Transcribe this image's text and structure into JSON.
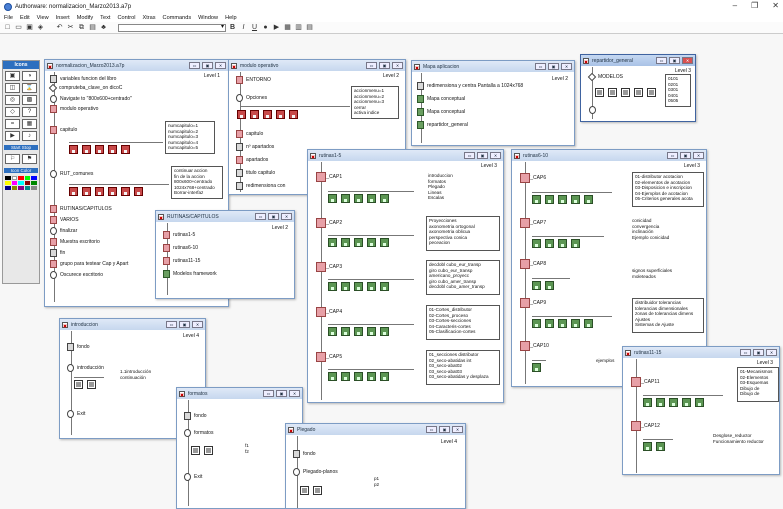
{
  "app": {
    "title": "Authorware: normalizacion_Marzo2013.a7p"
  },
  "menu": [
    "File",
    "Edit",
    "View",
    "Insert",
    "Modify",
    "Text",
    "Control",
    "Xtras",
    "Commands",
    "Window",
    "Help"
  ],
  "toolbar": {
    "bold": "B",
    "italic": "I",
    "underline": "U"
  },
  "palette": {
    "title": "Icons",
    "start_stop": "Start Stop",
    "icon_color": "Icon Color"
  },
  "win_main": {
    "title": "normalizacion_Marzo2013.a7p",
    "level": "Level 1",
    "items": [
      "variables funcion del libro",
      "compruteba_clave_on dicoC",
      "Navigate to \"800x600+centrado\"",
      "modulo operativo"
    ],
    "capitulo": "capitulo",
    "capitulo_list": [
      "numcapitulo=1",
      "numcapitulo=2",
      "numcapitulo=3",
      "numcapitulo=4",
      "numcapitulo=5"
    ],
    "rut_comunes": "RUT_comunes",
    "rut_box": [
      "continuar accion",
      "fin de la accion",
      "800x600+centrado",
      "1024x768+centrado",
      "Borrar-interfaz"
    ],
    "lower": [
      "RUTINAS/CAPITULOS",
      "VARIOS",
      "finalizar",
      "Muestra escritorio",
      "fin",
      "grupo para testear Cap y Apart",
      "Oscurece escritorio"
    ]
  },
  "win_modulo": {
    "title": "modulo operativo",
    "level": "Level 2",
    "entorno": "ENTORNO",
    "opciones": "Opciones",
    "acciones": [
      "accionmenu=1",
      "accionmenu=2",
      "accionmenu=3",
      "cerrar",
      "activa indice"
    ],
    "items": [
      "capitulo",
      "nº apartados",
      "apartados",
      "titulo capitulo",
      "redimensiona con"
    ]
  },
  "win_mapa": {
    "title": "Mapa aplicacion",
    "level": "Level 2",
    "items": [
      "redimensiona y centra Pantalla a 1024x768",
      "Mapa conceptual",
      "Mapa conceptual",
      "repartidor_general"
    ]
  },
  "win_repartidor": {
    "title": "repartidor_general",
    "level": "Level 3",
    "modelos": "MODELOS",
    "codes": [
      "0101",
      "0201",
      "0301",
      "0401",
      "0505"
    ]
  },
  "win_rutinas15": {
    "title": "rutinas1-5",
    "level": "Level 3",
    "caps": [
      {
        "name": "RUT_CAP1",
        "lines": [
          "introduccion",
          "formatos",
          "Plegado",
          "Lineas",
          "Escalas"
        ]
      },
      {
        "name": "RUT_CAP2",
        "lines": [
          "Proyecciones",
          "axonometria ortogonal",
          "axonometria oblicua",
          "perspectiva conica",
          "peceacion"
        ]
      },
      {
        "name": "RUT_CAP3",
        "lines": [
          "decdobl cubo_eur_transp",
          "giro cubo_eur_transp",
          "americano_proyecc",
          "giro cubo_amer_transp",
          "decdobl cubo_amer_transp"
        ]
      },
      {
        "name": "RUT_CAP4",
        "lines": [
          "01-Cortes_distributor",
          "02-Cortes_proceso",
          "03-Cortes-secciones",
          "04-Caracteris-cortes",
          "05-Clasificacion-cortes"
        ]
      },
      {
        "name": "RUT_CAP5",
        "lines": [
          "01_secciones distributor",
          "02_seco-abatidas int",
          "03_seco-abat02",
          "03_seco-abat03",
          "03_seco-abatidas y desplaza"
        ]
      }
    ]
  },
  "win_rutinas610": {
    "title": "rutinas6-10",
    "level": "Level 3",
    "caps": [
      {
        "name": "RUT_CAP6",
        "lines": [
          "01-distributor acotacion",
          "02-elementos de acotacion",
          "03-Disposicion e inscripcion",
          "04-Ejemplos de acotacion",
          "05-Criterios generales acota"
        ]
      },
      {
        "name": "RUT_CAP7",
        "lines": [
          "conicidad",
          "convergencia",
          "inclinación",
          "Ejemplo conicidad"
        ]
      },
      {
        "name": "RUT_CAP8",
        "lines": [
          "signos superficiales",
          "moleteados"
        ]
      },
      {
        "name": "RUT_CAP9",
        "lines": [
          "distribuidor tolerancias",
          "tolerancias dimensionales",
          "zonas de tolerancias dimens",
          "Ajustes",
          "Sistemas de Ajuste"
        ]
      },
      {
        "name": "RUT_CAP10",
        "lines": [
          "ejemplos"
        ]
      }
    ]
  },
  "win_rutcaps": {
    "title": "RUTINAS/CAPITULOS",
    "level": "Level 2",
    "items": [
      "rutinas1-5",
      "rutinas6-10",
      "rutinas11-15",
      "Modelos framework"
    ]
  },
  "win_intro": {
    "title": "introduccion",
    "level": "Level 4",
    "items": [
      "fondo",
      "introducción",
      "Exit"
    ],
    "note": [
      "1.1introducción",
      "continuación"
    ]
  },
  "win_formatos": {
    "title": "formatos",
    "items": [
      "fondo",
      "formatos",
      "Exit"
    ],
    "f": [
      "f1",
      "f2"
    ]
  },
  "win_plegado": {
    "title": "Plegado",
    "level": "Level 4",
    "items": [
      "fondo",
      "Plegado-planos"
    ],
    "p": [
      "p1",
      "p2"
    ]
  },
  "win_rutinas1115": {
    "title": "rutinas11-15",
    "level": "Level 3",
    "caps": [
      {
        "name": "RUT_CAP11",
        "lines": [
          "01-Mecanismos",
          "02-Elementos",
          "03-Esquemas",
          "Dibujo de",
          "Dibujo de"
        ]
      },
      {
        "name": "RUT_CAP12",
        "lines": [
          "Desglose_reductor",
          "Funcionamiento reductor"
        ]
      }
    ]
  }
}
